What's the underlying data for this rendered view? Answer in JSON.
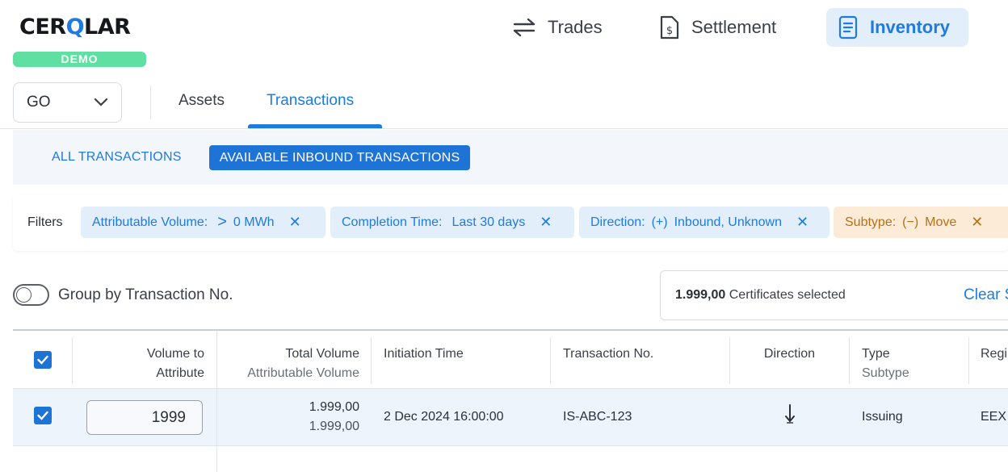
{
  "brand": {
    "logo_pre": "CER",
    "logo_q": "Q",
    "logo_post": "LAR",
    "badge": "DEMO"
  },
  "nav": {
    "trades": "Trades",
    "settlement": "Settlement",
    "inventory": "Inventory"
  },
  "registry_select": {
    "value": "GO"
  },
  "tabs": {
    "assets": "Assets",
    "transactions": "Transactions"
  },
  "subfilters": {
    "all": "ALL TRANSACTIONS",
    "available": "AVAILABLE INBOUND TRANSACTIONS"
  },
  "filters": {
    "label": "Filters",
    "chips": [
      {
        "key": "Attributable Volume:",
        "op": ">",
        "value": "0 MWh"
      },
      {
        "key": "Completion Time:",
        "value": "Last 30 days"
      },
      {
        "key": "Direction:",
        "op": "(+)",
        "value": "Inbound, Unknown"
      },
      {
        "key": "Subtype:",
        "op": "(−)",
        "value": "Move"
      }
    ]
  },
  "group_toggle": {
    "label": "Group by Transaction No.",
    "on": false
  },
  "selection": {
    "count": "1.999,00",
    "label": "Certificates selected",
    "clear": "Clear S"
  },
  "table": {
    "headers": {
      "volume_to_attribute_1": "Volume to",
      "volume_to_attribute_2": "Attribute",
      "total_volume": "Total Volume",
      "attributable_volume": "Attributable Volume",
      "initiation_time": "Initiation Time",
      "transaction_no": "Transaction No.",
      "direction": "Direction",
      "type": "Type",
      "subtype": "Subtype",
      "registry": "Regi"
    },
    "rows": [
      {
        "checked": true,
        "volume_to_attribute": "1999",
        "total_volume": "1.999,00",
        "attributable_volume": "1.999,00",
        "initiation_time": "2 Dec 2024 16:00:00",
        "transaction_no": "IS-ABC-123",
        "direction_icon": "arrow-down-icon",
        "type": "Issuing",
        "registry": "EEX"
      }
    ]
  },
  "colors": {
    "accent": "#1e7be0",
    "demo": "#5fe0a2",
    "subtype_chip": "#fcebd6"
  }
}
